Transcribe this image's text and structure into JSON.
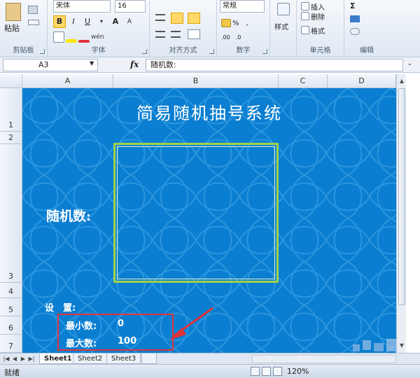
{
  "ribbon": {
    "groups": {
      "clipboard": "剪贴板",
      "font": "字体",
      "alignment": "对齐方式",
      "number": "数字",
      "cells": "单元格",
      "editing": "编辑"
    },
    "paste_label": "粘贴",
    "font_name": "宋体",
    "font_size": "16",
    "bold": "B",
    "italic": "I",
    "underline": "U",
    "font_grow": "A",
    "font_shrink": "A",
    "number_format": "常规",
    "percent": "%",
    "comma": ",",
    "styles_label": "样式",
    "insert_label": "插入",
    "delete_label": "删除",
    "format_label": "格式",
    "wen": "wén"
  },
  "formula_bar": {
    "name_box": "A3",
    "fx": "fx",
    "content": "随机数:"
  },
  "columns": [
    "A",
    "B",
    "C",
    "D"
  ],
  "rows": [
    "1",
    "2",
    "3",
    "4",
    "5",
    "6",
    "7"
  ],
  "sheet_content": {
    "title": "简易随机抽号系统",
    "random_label": "随机数:",
    "settings_label": "设　置:",
    "min_label": "最小数:",
    "min_value": "0",
    "max_label": "最大数:",
    "max_value": "100"
  },
  "tabs": [
    "Sheet1",
    "Sheet2",
    "Sheet3"
  ],
  "status": {
    "ready": "就绪",
    "zoom": "120%"
  },
  "colors": {
    "sheet_bg": "#0a7ed1",
    "frame": "#9fd24a",
    "highlight": "#e0343a"
  }
}
